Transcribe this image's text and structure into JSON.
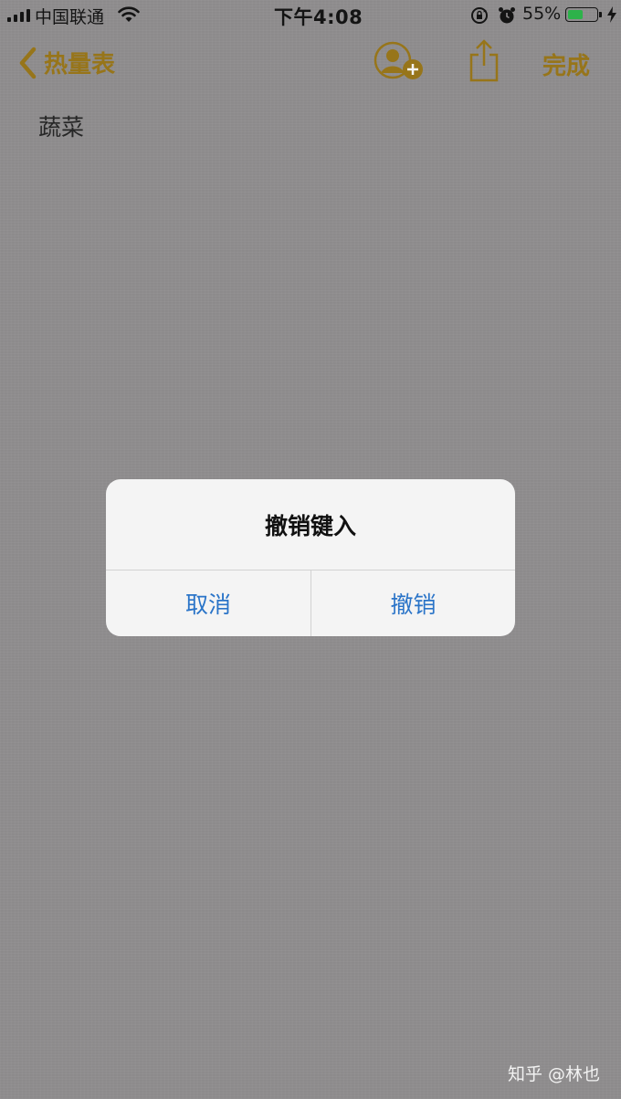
{
  "status_bar": {
    "carrier": "中国联通",
    "time": "下午4:08",
    "battery_percent": "55%",
    "battery_level": 0.55,
    "battery_color": "#2db24a"
  },
  "nav": {
    "back_label": "热量表",
    "done_label": "完成",
    "accent_color": "#97751a",
    "icons": [
      "chevron-left-icon",
      "add-person-icon",
      "share-icon"
    ]
  },
  "note": {
    "body": "蔬菜"
  },
  "alert": {
    "title": "撤销键入",
    "cancel_label": "取消",
    "undo_label": "撤销",
    "button_color": "#2a74c8"
  },
  "watermark": "知乎 @林也"
}
